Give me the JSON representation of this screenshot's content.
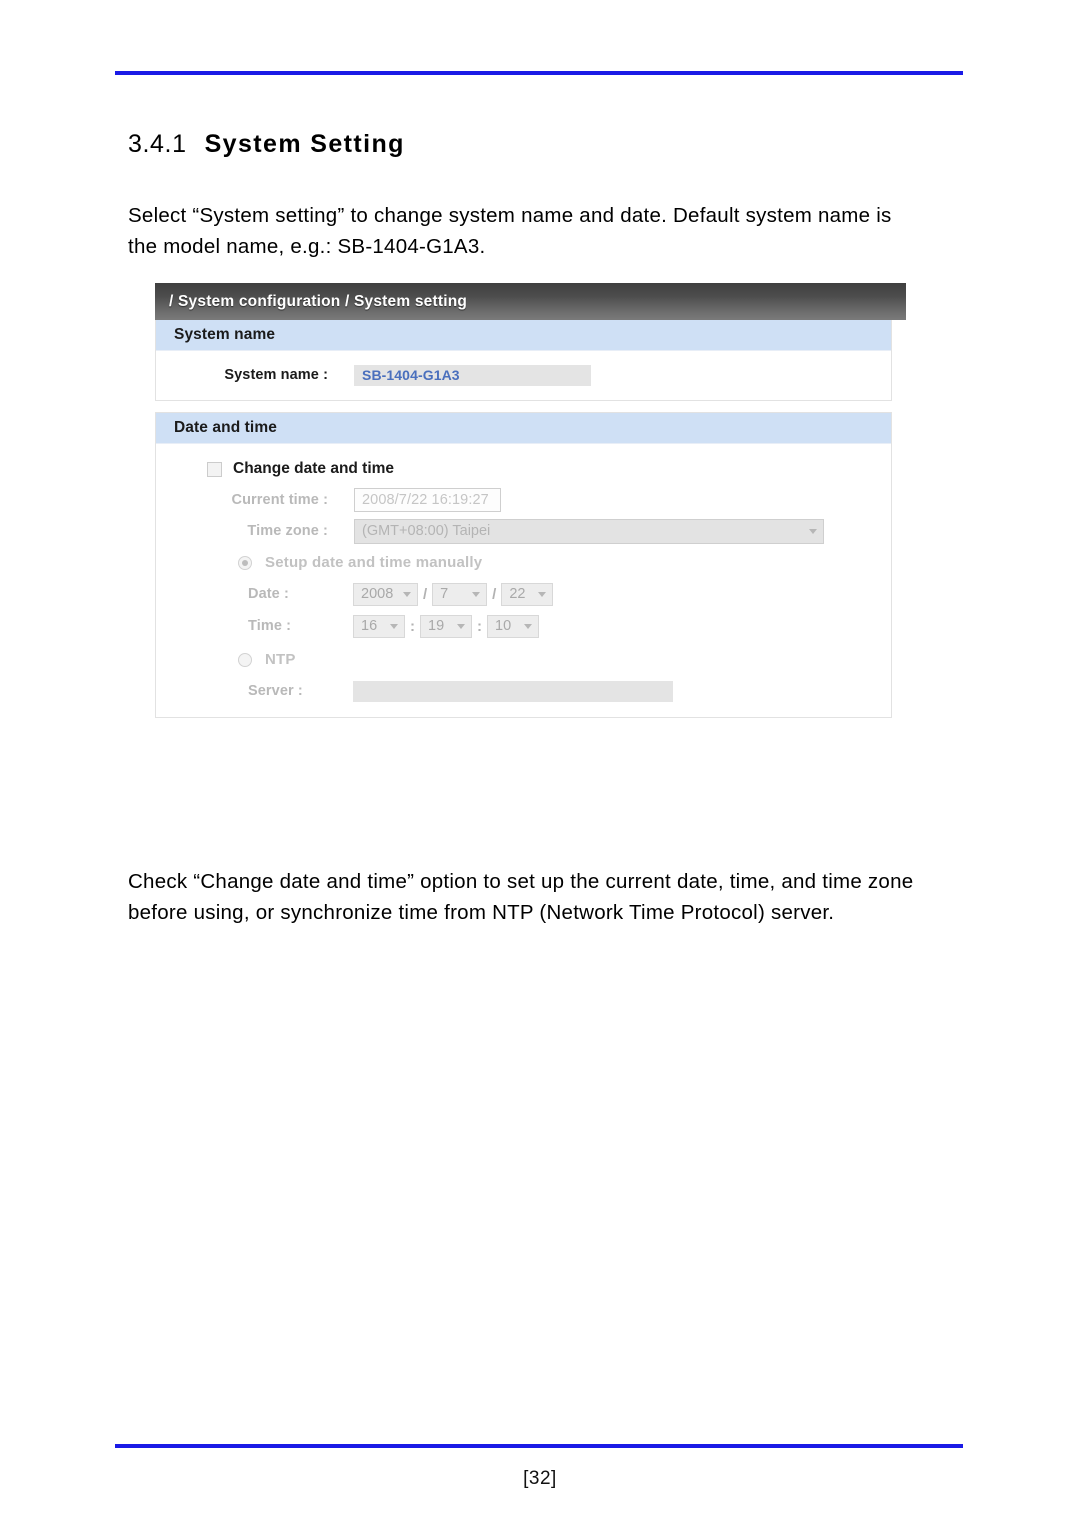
{
  "document": {
    "heading_number": "3.4.1",
    "heading_title": "System Setting",
    "intro_paragraph": "Select “System setting” to change system name and date. Default system name is the model name, e.g.: SB-1404-G1A3.",
    "outro_paragraph": "Check “Change date and time” option to set up the current date, time, and time zone before using, or synchronize time from NTP (Network Time Protocol) server.",
    "page_number": "[32]",
    "rule_color": "#1a1ae6"
  },
  "screenshot": {
    "breadcrumb": "/ System configuration / System setting",
    "header_color": "#4c4c4c",
    "group_title_color": "#cfe0f5",
    "accent_value_color": "#4a6fbd",
    "system_name_group": {
      "title": "System name",
      "field_label": "System name :",
      "field_value": "SB-1404-G1A3"
    },
    "date_time_group": {
      "title": "Date and time",
      "change_checkbox_label": "Change date and time",
      "change_checkbox_checked": false,
      "current_time_label": "Current time :",
      "current_time_value": "2008/7/22 16:19:27",
      "time_zone_label": "Time zone :",
      "time_zone_value": "(GMT+08:00) Taipei",
      "manual_radio_label": "Setup date and time manually",
      "manual_radio_selected": true,
      "date_label": "Date :",
      "date_year": "2008",
      "date_month": "7",
      "date_day": "22",
      "date_separator": "/",
      "time_label": "Time :",
      "time_hour": "16",
      "time_minute": "19",
      "time_second": "10",
      "time_separator": ":",
      "ntp_radio_label": "NTP",
      "ntp_radio_selected": false,
      "server_label": "Server :",
      "server_value": ""
    }
  }
}
